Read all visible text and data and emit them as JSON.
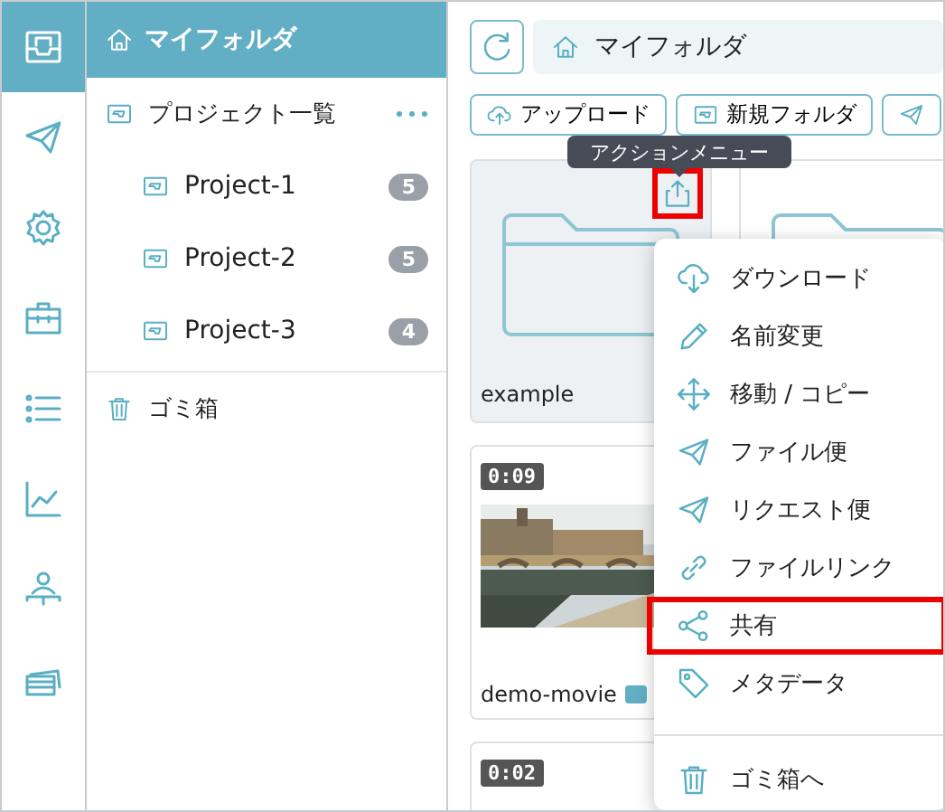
{
  "rail": [
    {
      "kind": "inbox",
      "selected": true
    },
    {
      "kind": "send",
      "selected": false
    },
    {
      "kind": "gear",
      "selected": false
    },
    {
      "kind": "toolbox",
      "selected": false
    },
    {
      "kind": "list",
      "selected": false
    },
    {
      "kind": "chart",
      "selected": false
    },
    {
      "kind": "org",
      "selected": false
    },
    {
      "kind": "cards",
      "selected": false
    }
  ],
  "sidebar": {
    "header": "マイフォルダ",
    "items": [
      {
        "label": "プロジェクト一覧",
        "kind": "folder",
        "children": [
          {
            "label": "Project-1",
            "count": "5"
          },
          {
            "label": "Project-2",
            "count": "5"
          },
          {
            "label": "Project-3",
            "count": "4"
          }
        ]
      },
      {
        "label": "ゴミ箱",
        "kind": "trash"
      }
    ]
  },
  "breadcrumb": "マイフォルダ",
  "toolbar": [
    {
      "label": "アップロード",
      "kind": "upload"
    },
    {
      "label": "新規フォルダ",
      "kind": "folder"
    },
    {
      "kind": "send"
    }
  ],
  "columns": [
    [
      {
        "kind": "folder",
        "name": "example",
        "selected": true
      },
      {
        "kind": "video",
        "duration": "0:09",
        "name": "demo-movie"
      },
      {
        "kind": "video",
        "duration": "0:02"
      }
    ],
    [
      {
        "kind": "folder",
        "selected": false
      }
    ]
  ],
  "tooltip": "アクションメニュー",
  "menu": [
    {
      "label": "ダウンロード",
      "kind": "download",
      "highlighted": false
    },
    {
      "label": "名前変更",
      "kind": "pencil",
      "highlighted": false
    },
    {
      "label": "移動 / コピー",
      "kind": "move",
      "highlighted": false
    },
    {
      "label": "ファイル便",
      "kind": "send",
      "highlighted": false
    },
    {
      "label": "リクエスト便",
      "kind": "send",
      "highlighted": false
    },
    {
      "label": "ファイルリンク",
      "kind": "link",
      "highlighted": false
    },
    {
      "label": "共有",
      "kind": "share",
      "highlighted": true
    },
    {
      "label": "メタデータ",
      "kind": "tag",
      "highlighted": false
    },
    {
      "label": "ゴミ箱へ",
      "kind": "trash",
      "highlighted": false,
      "separator_before": true
    }
  ]
}
